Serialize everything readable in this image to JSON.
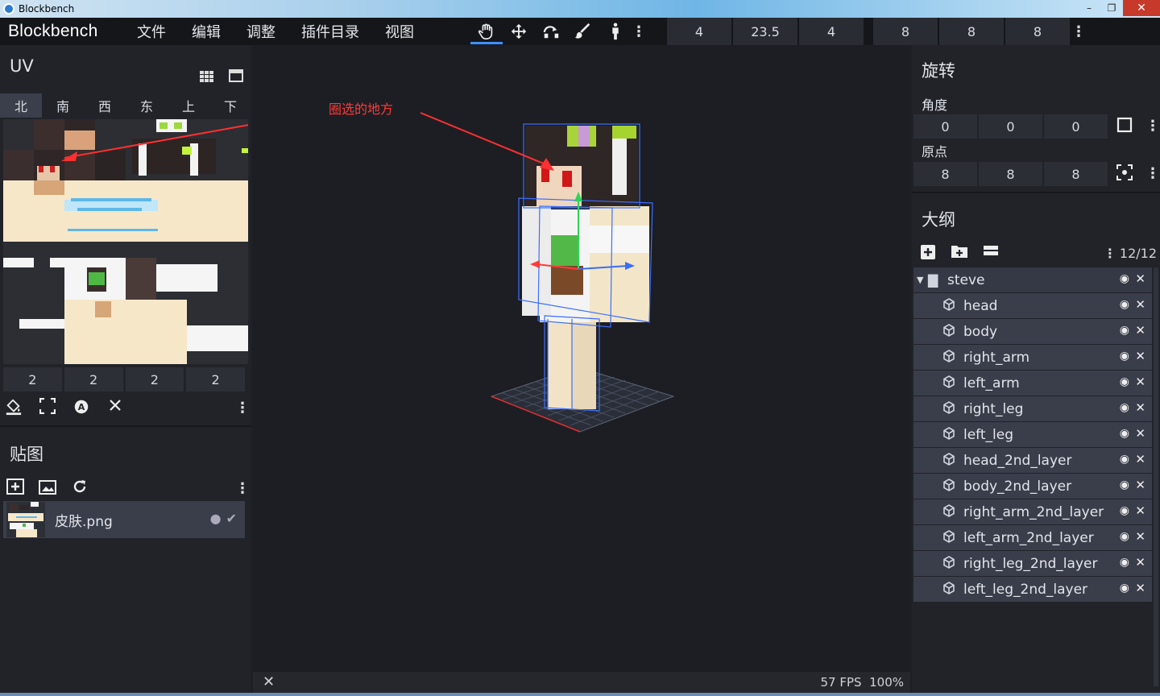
{
  "window": {
    "title": "Blockbench",
    "minimize": "–",
    "restore": "❐",
    "close": "✕"
  },
  "menubar": {
    "brand": "Blockbench",
    "items": [
      "文件",
      "编辑",
      "调整",
      "插件目录",
      "视图"
    ],
    "tools": [
      "hand-icon",
      "move-icon",
      "rotate-icon",
      "brush-icon",
      "pose-icon"
    ],
    "values_a": [
      "4",
      "23.5",
      "4"
    ],
    "values_b": [
      "8",
      "8",
      "8"
    ]
  },
  "uv_panel": {
    "title": "UV",
    "faces": [
      "北",
      "南",
      "西",
      "东",
      "上",
      "下"
    ],
    "selected_face": "北",
    "sizes": [
      "2",
      "2",
      "2",
      "2"
    ]
  },
  "annotation": {
    "text": "圈选的地方",
    "color": "#ff3a3a"
  },
  "texture_panel": {
    "title": "贴图",
    "texture_name": "皮肤.png"
  },
  "viewport": {
    "fps": "57 FPS",
    "zoom": "100%",
    "close": "✕"
  },
  "rotation_panel": {
    "title": "旋转",
    "angle_label": "角度",
    "angle": [
      "0",
      "0",
      "0"
    ],
    "origin_label": "原点",
    "origin": [
      "8",
      "8",
      "8"
    ]
  },
  "outliner": {
    "title": "大纲",
    "count": "12/12",
    "group": "steve",
    "items": [
      "head",
      "body",
      "right_arm",
      "left_arm",
      "right_leg",
      "left_leg",
      "head_2nd_layer",
      "body_2nd_layer",
      "right_arm_2nd_layer",
      "left_arm_2nd_layer",
      "right_leg_2nd_layer",
      "left_leg_2nd_layer"
    ]
  },
  "colors": {
    "accent": "#3e90ff",
    "background": "#1e1f24",
    "panel": "#212329",
    "selection": "#3a3e4b"
  }
}
